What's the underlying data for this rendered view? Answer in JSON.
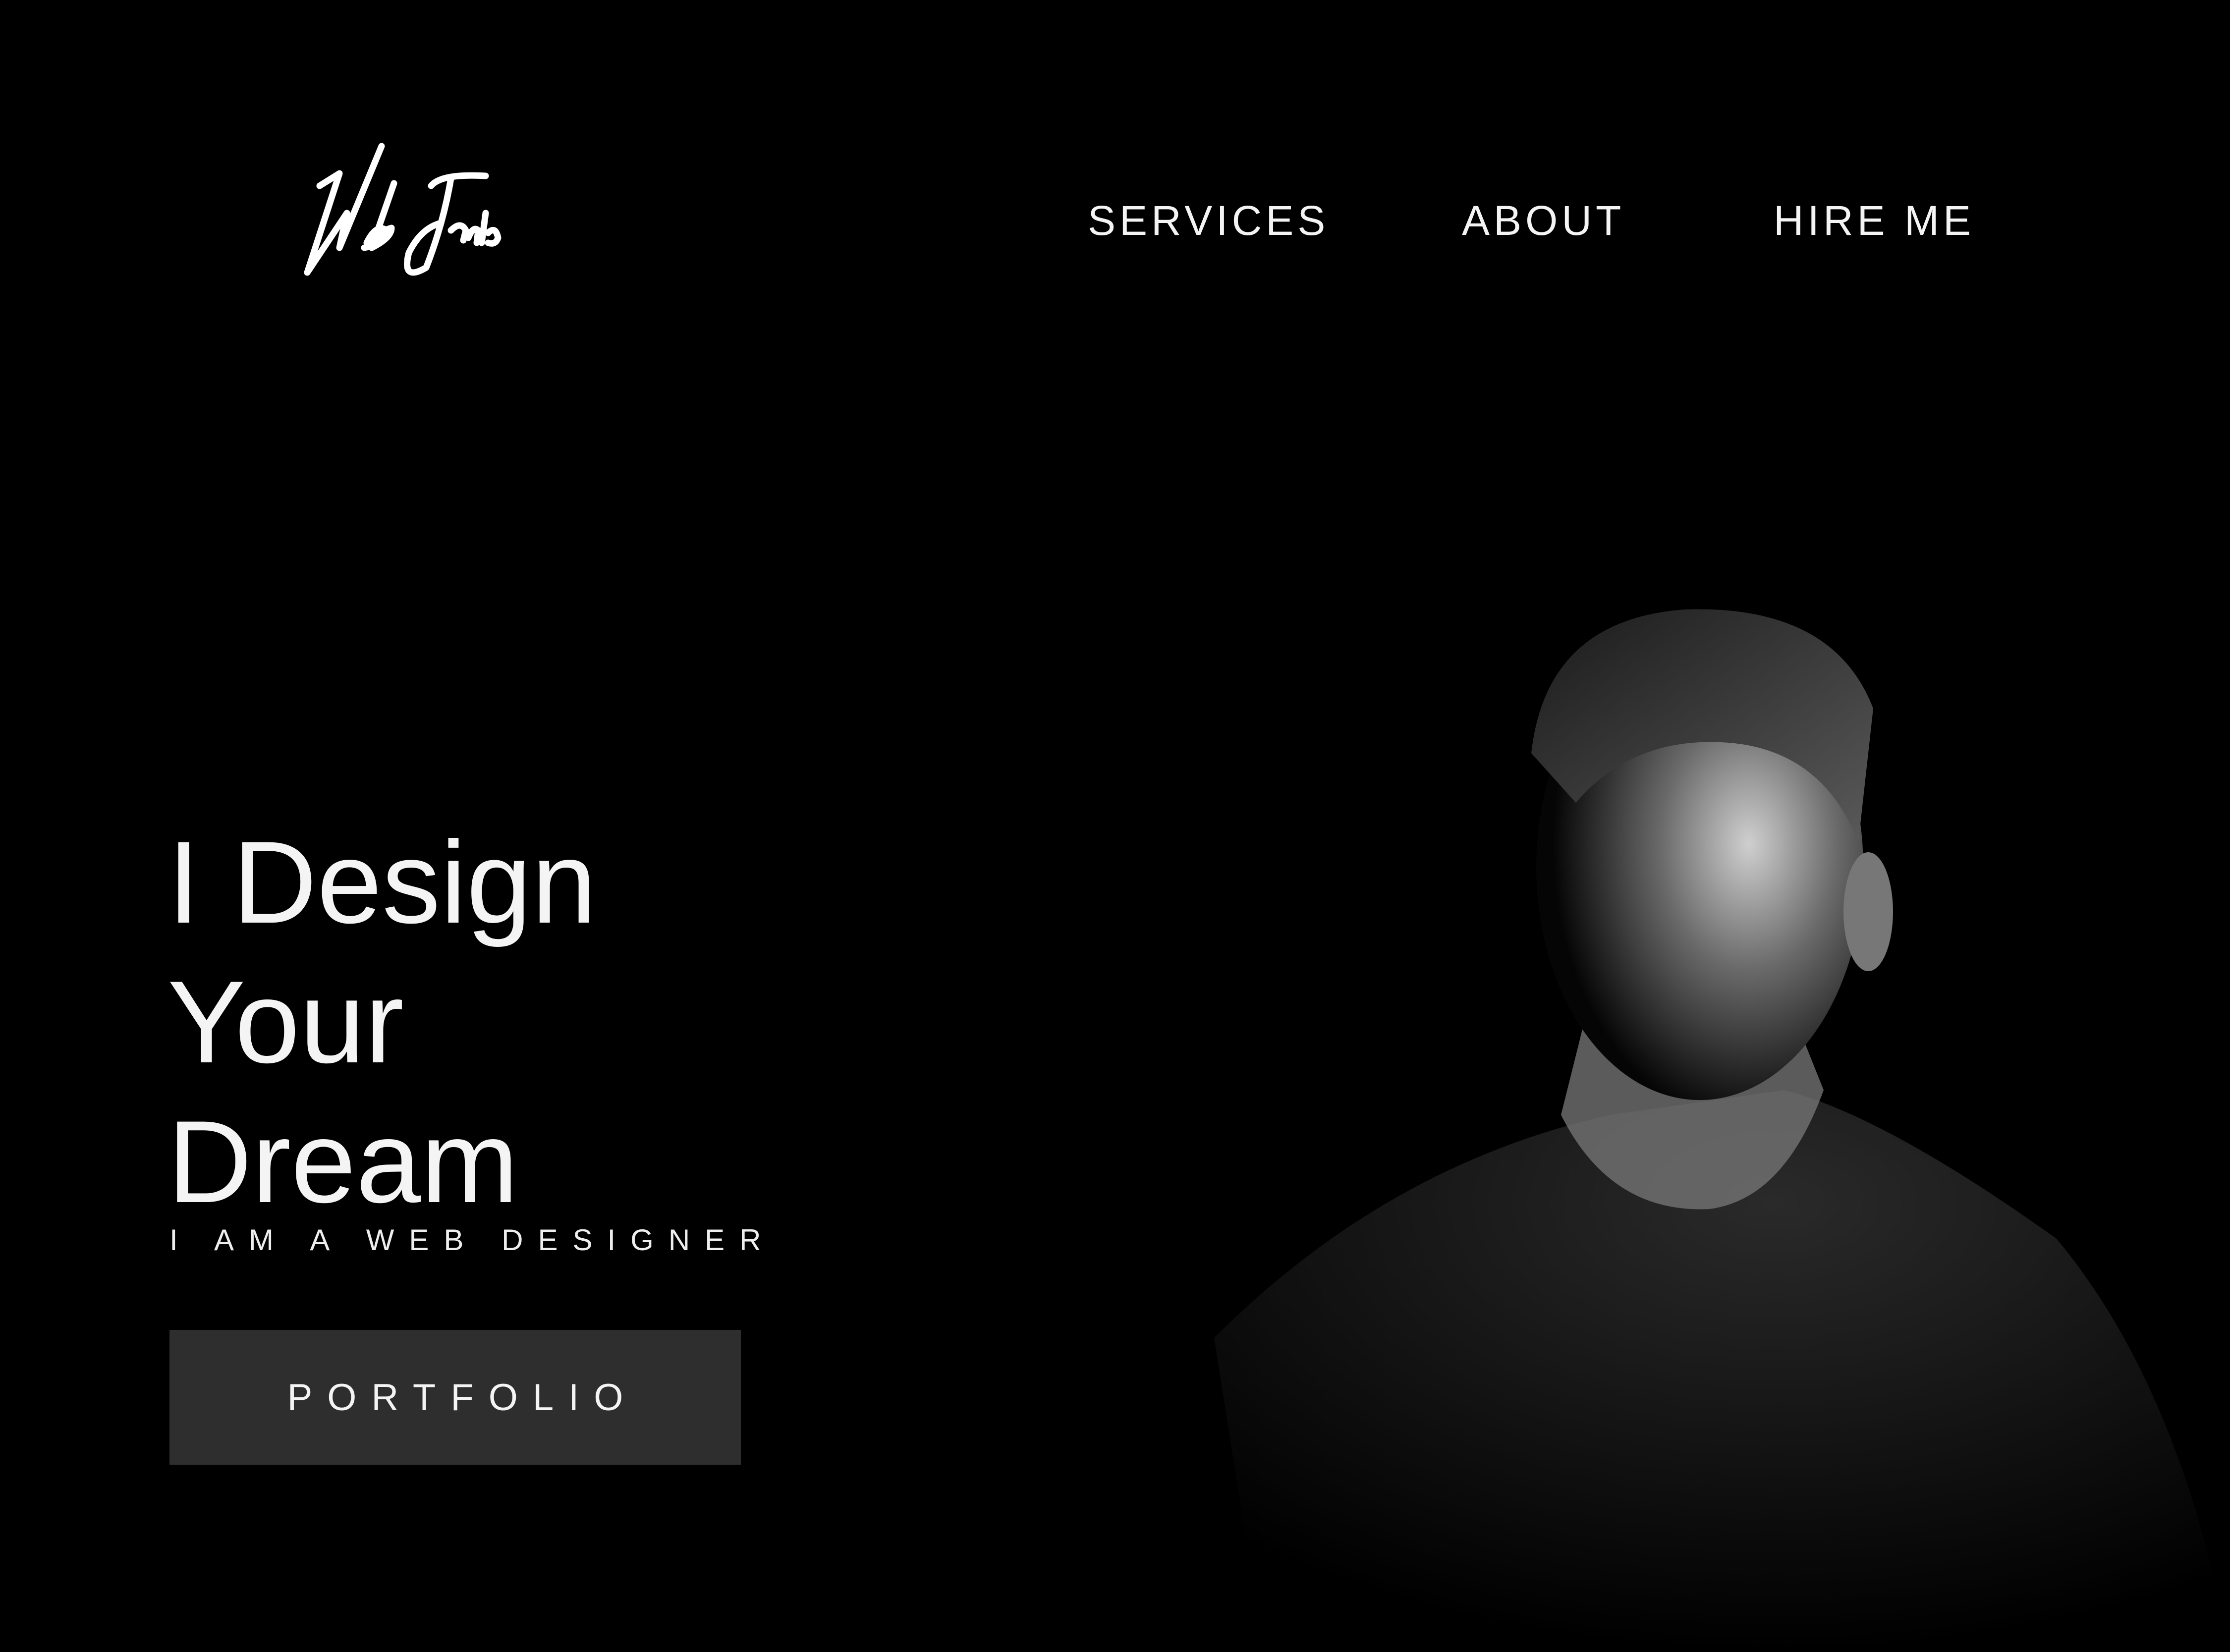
{
  "brand": {
    "logo_text": "Web Janis"
  },
  "nav": {
    "items": [
      {
        "label": "SERVICES"
      },
      {
        "label": "ABOUT"
      },
      {
        "label": "HIRE ME"
      }
    ]
  },
  "hero": {
    "title_lines": [
      "I Design",
      "Your",
      "Dream"
    ],
    "subtitle": "I AM A WEB DESIGNER",
    "cta_label": "PORTFOLIO"
  },
  "colors": {
    "background": "#000000",
    "button": "#2e2e2e",
    "text": "#f4f4f4"
  }
}
